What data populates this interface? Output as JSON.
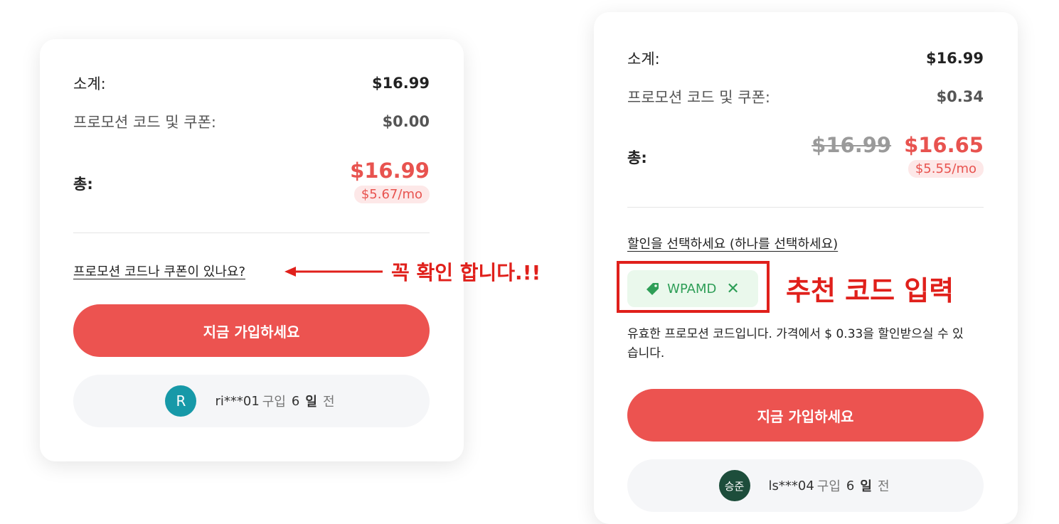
{
  "left_card": {
    "subtotal_label": "소계:",
    "subtotal_value": "$16.99",
    "promo_label": "프로모션 코드 및 쿠폰:",
    "promo_value": "$0.00",
    "total_label": "총:",
    "total_value": "$16.99",
    "per_month": "$5.67/mo",
    "promo_link": "프로모션 코드나 쿠폰이 있나요?",
    "cta_label": "지금 가입하세요",
    "social_proof": {
      "avatar_initial": "R",
      "avatar_color": "#1799a8",
      "user": "ri***01",
      "purchased": "구입",
      "days": "6",
      "day_unit": "일",
      "ago": "전"
    }
  },
  "right_card": {
    "subtotal_label": "소계:",
    "subtotal_value": "$16.99",
    "promo_label": "프로모션 코드 및 쿠폰:",
    "promo_value": "$0.34",
    "total_label": "총:",
    "old_total": "$16.99",
    "total_value": "$16.65",
    "per_month": "$5.55/mo",
    "discount_link": "할인을 선택하세요 (하나를 선택하세요)",
    "coupon_code": "WPAMD",
    "valid_message": "유효한 프로모션 코드입니다. 가격에서 $ 0.33을 할인받으실 수 있습니다.",
    "cta_label": "지금 가입하세요",
    "social_proof": {
      "avatar_initial": "승준",
      "avatar_color": "#1d4d3b",
      "user": "ls***04",
      "purchased": "구입",
      "days": "6",
      "day_unit": "일",
      "ago": "전"
    }
  },
  "annotations": {
    "confirm_text": "꼭 확인 합니다.!!",
    "recommend_text": "추천 코드 입력",
    "color": "#e0201b"
  },
  "colors": {
    "accent": "#ec5350",
    "price_red": "#e8534f",
    "coupon_green": "#2e9e57"
  }
}
